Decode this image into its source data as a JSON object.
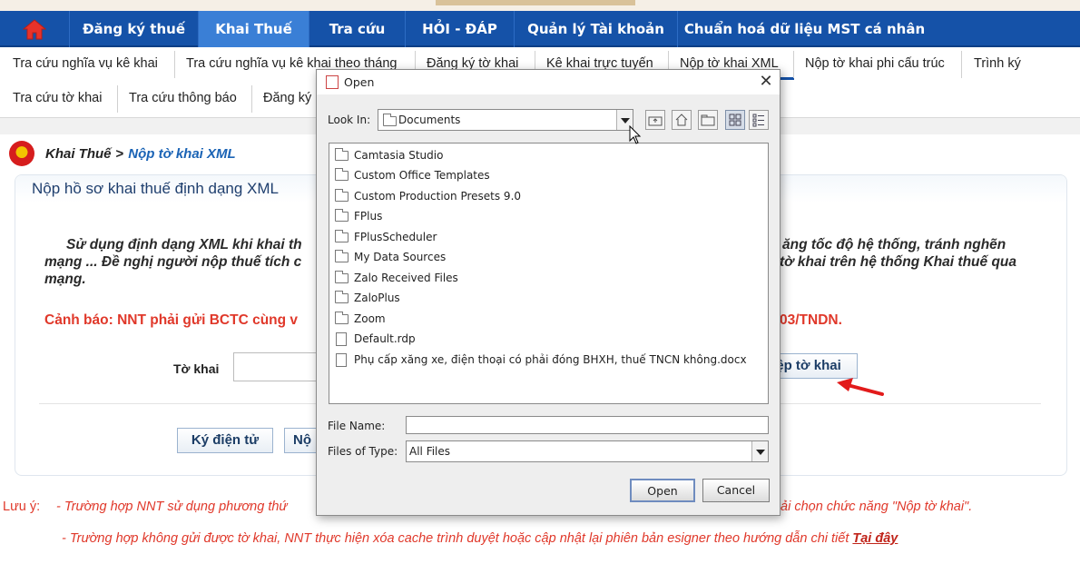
{
  "nav": {
    "items": [
      "Đăng ký thuế",
      "Khai Thuế",
      "Tra cứu",
      "HỎI - ĐÁP",
      "Quản lý Tài khoản",
      "Chuẩn hoá dữ liệu MST cá nhân"
    ]
  },
  "subnav": {
    "row1": [
      "Tra cứu nghĩa vụ kê khai",
      "Tra cứu nghĩa vụ kê khai theo tháng",
      "Đăng ký tờ khai",
      "Kê khai trực tuyến",
      "Nộp tờ khai XML",
      "Nộp tờ khai phi cấu trúc",
      "Trình ký"
    ],
    "row2": [
      "Tra cứu tờ khai",
      "Tra cứu thông báo",
      "Đăng ký"
    ]
  },
  "breadcrumb": {
    "parent": "Khai Thuế",
    "sep": ">",
    "current": "Nộp tờ khai XML"
  },
  "panel": {
    "title": "Nộp hồ sơ khai thuế định dạng XML",
    "note_l1_left": "Sử dụng định dạng XML khi khai th",
    "note_l1_right": "ăng tốc độ hệ thống, tránh nghẽn",
    "note_l2_left": "mạng ... Đề nghị người nộp thuế tích c",
    "note_l2_right": "tờ khai trên hệ thống Khai thuế qua",
    "note_l3": "mạng.",
    "warn_left": "Cảnh báo: NNT phải gửi BCTC cùng v",
    "warn_right": "03/TNDN.",
    "tokhai_label": "Tờ khai",
    "choose_btn": "ệp tờ khai",
    "sign_btn": "Ký điện tử",
    "submit_btn": "Nộ"
  },
  "footer": {
    "label": "Lưu ý:",
    "line1_left": "- Trường hợp NNT sử dụng phương thứ",
    "line1_right": "ải chọn chức năng \"Nộp tờ khai\".",
    "line2": "- Trường hợp không gửi được tờ khai, NNT thực hiện xóa cache trình duyệt hoặc cập nhật lại phiên bản esigner theo hướng dẫn chi tiết",
    "line2_link": "Tại đây"
  },
  "dialog": {
    "title": "Open",
    "look_in_label": "Look In:",
    "look_in_value": "Documents",
    "files": [
      {
        "name": "Camtasia Studio",
        "type": "folder"
      },
      {
        "name": "Custom Office Templates",
        "type": "folder"
      },
      {
        "name": "Custom Production Presets 9.0",
        "type": "folder"
      },
      {
        "name": "FPlus",
        "type": "folder"
      },
      {
        "name": "FPlusScheduler",
        "type": "folder"
      },
      {
        "name": "My Data Sources",
        "type": "folder"
      },
      {
        "name": "Zalo Received Files",
        "type": "folder"
      },
      {
        "name": "ZaloPlus",
        "type": "folder"
      },
      {
        "name": "Zoom",
        "type": "folder"
      },
      {
        "name": "Default.rdp",
        "type": "file"
      },
      {
        "name": "Phụ cấp xăng xe, điện thoại có phải đóng BHXH, thuế TNCN không.docx",
        "type": "file"
      }
    ],
    "file_name_label": "File Name:",
    "file_name_value": "",
    "files_of_type_label": "Files of Type:",
    "files_of_type_value": "All Files",
    "open_btn": "Open",
    "cancel_btn": "Cancel"
  },
  "colors": {
    "nav_bg": "#1552a8",
    "nav_active": "#3a7fd6",
    "warning": "#e0382a",
    "link": "#1a63b5"
  }
}
